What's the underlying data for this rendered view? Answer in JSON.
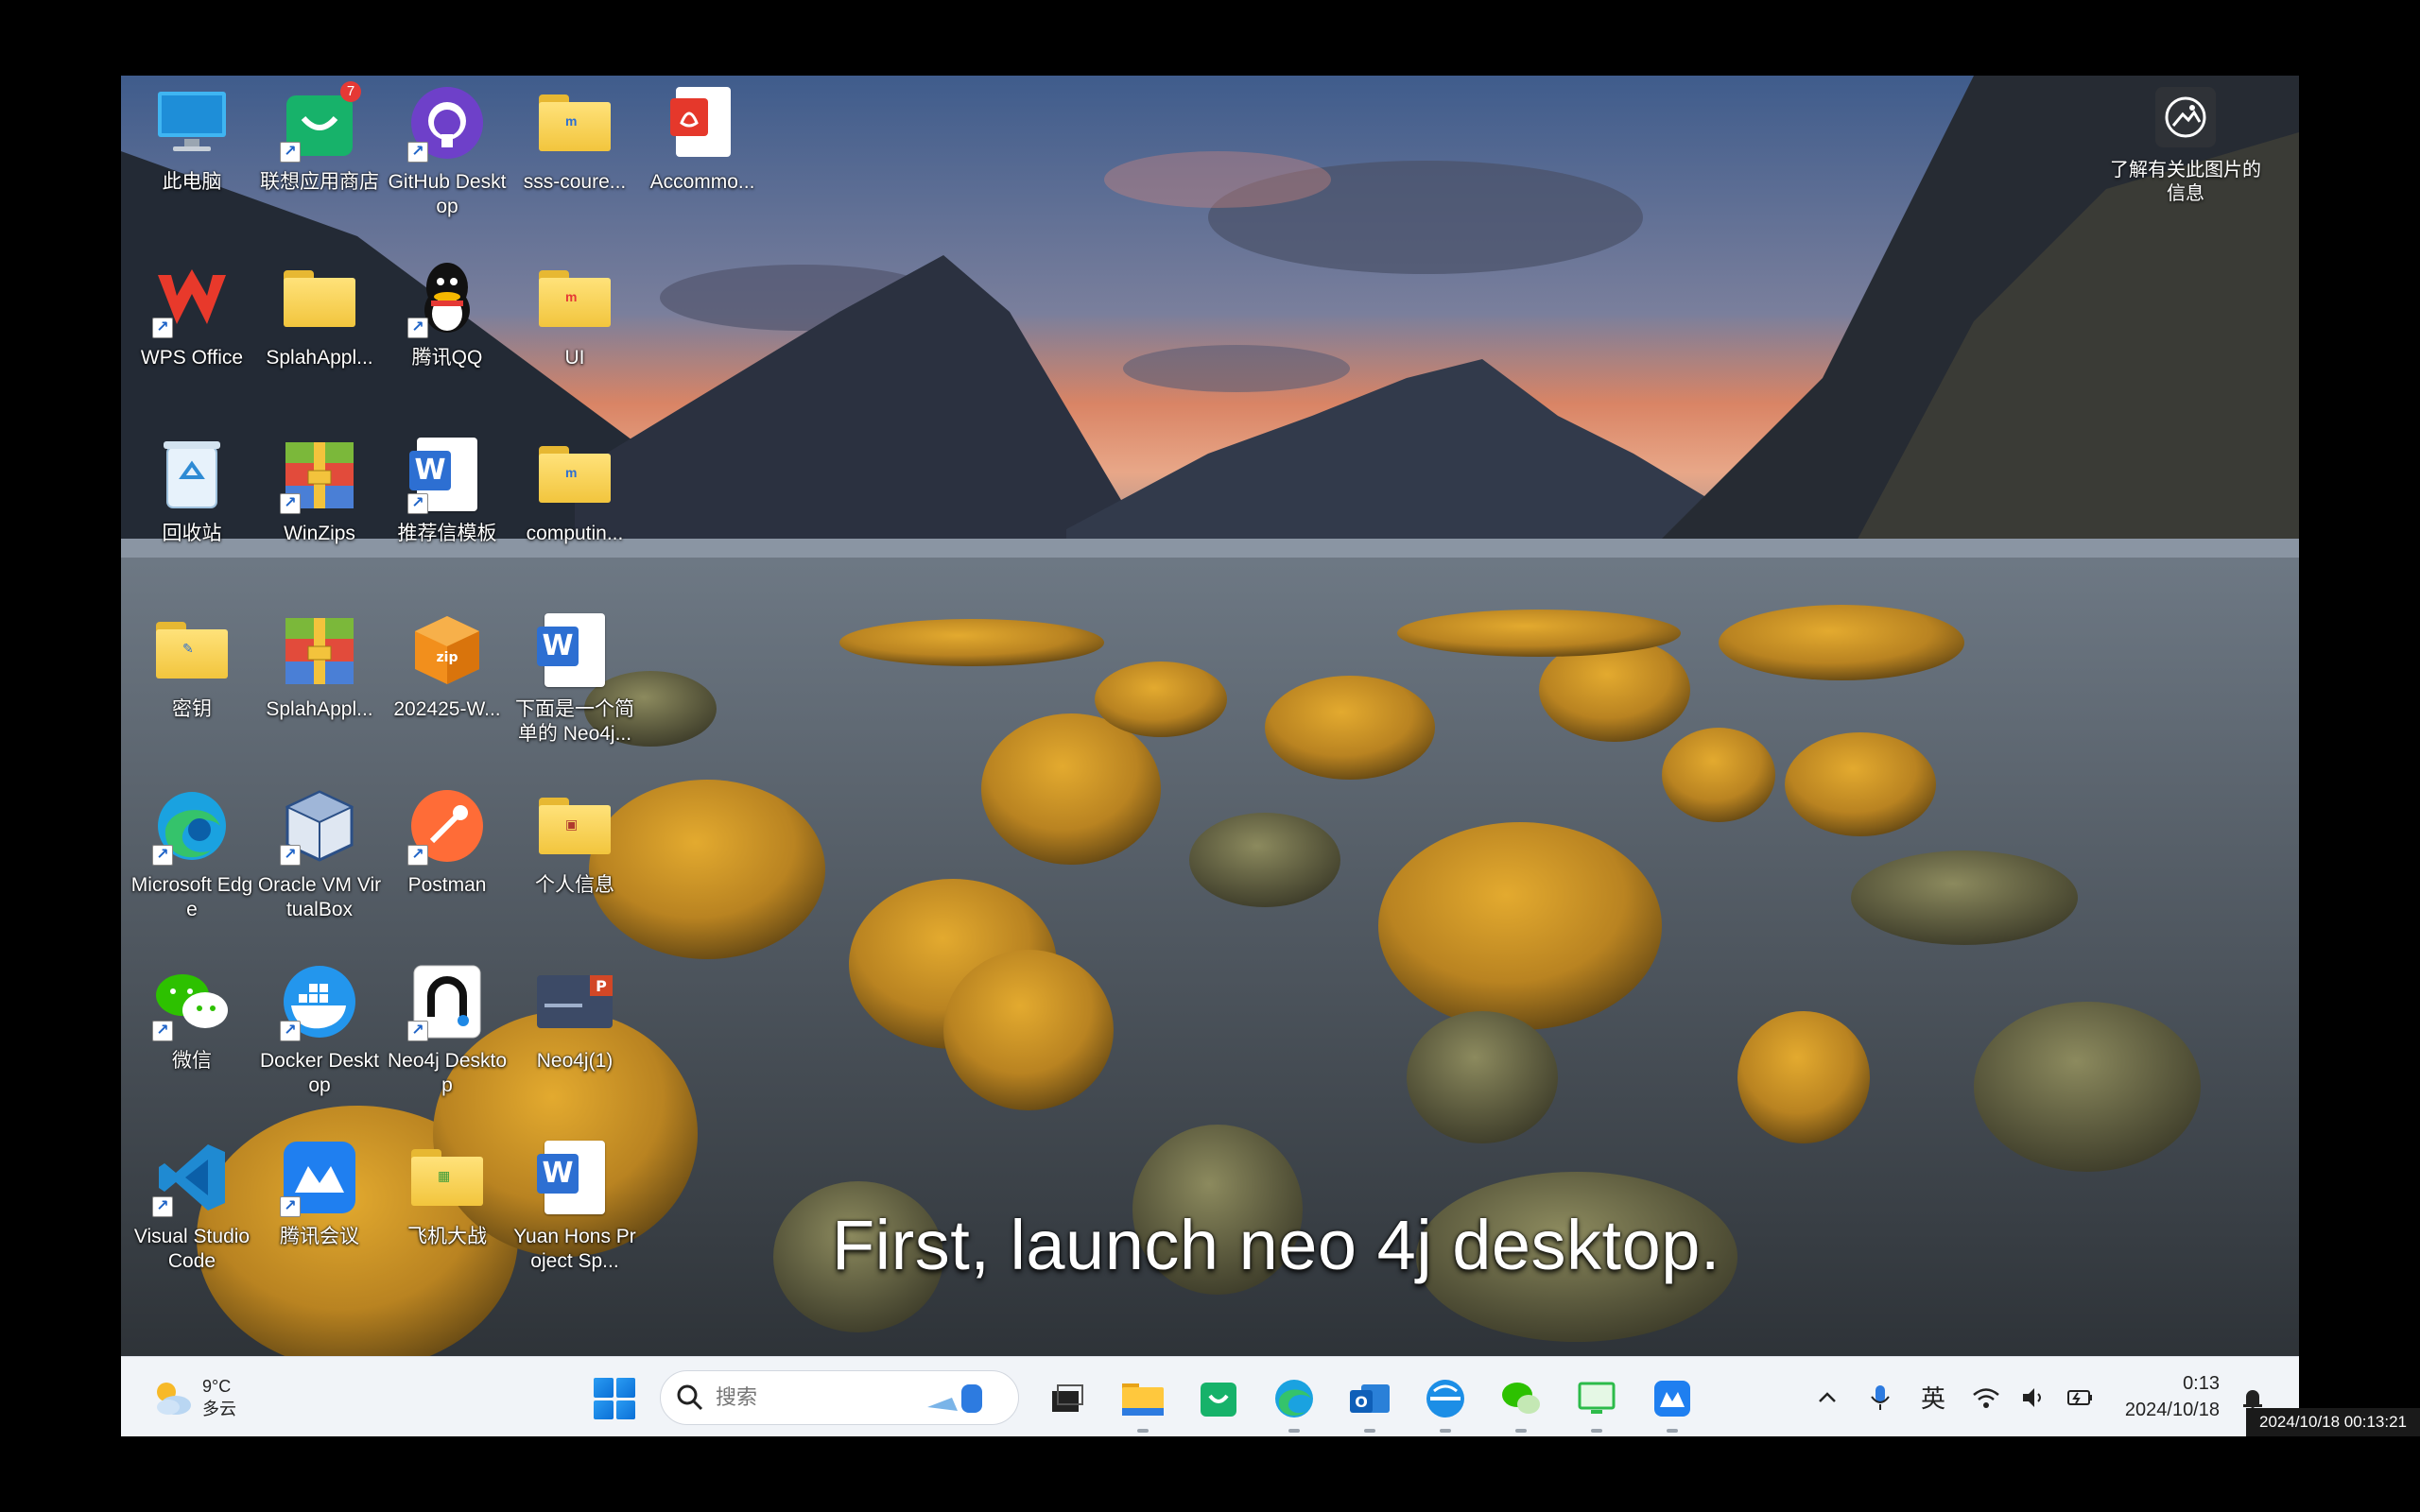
{
  "desktop": {
    "icons": [
      {
        "label": "此电脑",
        "icon": "computer-icon"
      },
      {
        "label": "联想应用商店",
        "icon": "lenovo-store-icon",
        "badge": "7"
      },
      {
        "label": "GitHub Desktop",
        "icon": "github-icon"
      },
      {
        "label": "sss-coure...",
        "icon": "folder-icon"
      },
      {
        "label": "Accommo...",
        "icon": "pdf-icon"
      },
      {
        "label": "WPS Office",
        "icon": "wps-icon"
      },
      {
        "label": "SplahAppl...",
        "icon": "folder-icon"
      },
      {
        "label": "腾讯QQ",
        "icon": "qq-icon"
      },
      {
        "label": "UI",
        "icon": "folder-icon"
      },
      {
        "label": "回收站",
        "icon": "recycle-bin-icon"
      },
      {
        "label": "WinZips",
        "icon": "winzip-icon"
      },
      {
        "label": "推荐信模板",
        "icon": "word-doc-icon"
      },
      {
        "label": "computin...",
        "icon": "folder-icon"
      },
      {
        "label": "密钥",
        "icon": "folder-icon"
      },
      {
        "label": "SplahAppl...",
        "icon": "winzip-icon"
      },
      {
        "label": "202425-W...",
        "icon": "archive-icon"
      },
      {
        "label": "下面是一个简单的 Neo4j...",
        "icon": "word-doc-icon"
      },
      {
        "label": "Microsoft Edge",
        "icon": "edge-icon"
      },
      {
        "label": "Oracle VM VirtualBox",
        "icon": "virtualbox-icon"
      },
      {
        "label": "Postman",
        "icon": "postman-icon"
      },
      {
        "label": "个人信息",
        "icon": "folder-icon"
      },
      {
        "label": "微信",
        "icon": "wechat-icon"
      },
      {
        "label": "Docker Desktop",
        "icon": "docker-icon"
      },
      {
        "label": "Neo4j Desktop",
        "icon": "neo4j-icon"
      },
      {
        "label": "Neo4j(1)",
        "icon": "ppt-icon"
      },
      {
        "label": "Visual Studio Code",
        "icon": "vscode-icon"
      },
      {
        "label": "腾讯会议",
        "icon": "tencent-meeting-icon"
      },
      {
        "label": "飞机大战",
        "icon": "folder-icon"
      },
      {
        "label": "Yuan Hons Project Sp...",
        "icon": "word-doc-icon"
      }
    ]
  },
  "info_widget": {
    "label": "了解有关此图片的信息"
  },
  "subtitle": "First, launch neo 4j desktop.",
  "taskbar": {
    "weather": {
      "temp": "9°C",
      "condition": "多云"
    },
    "search_placeholder": "搜索",
    "pinned_apps": [
      "file-explorer-icon",
      "folder-icon",
      "lenovo-store-icon",
      "edge-icon",
      "outlook-icon",
      "browser-icon",
      "wechat-icon",
      "remote-desktop-icon",
      "tencent-meeting-icon"
    ],
    "tray": {
      "ime": "英"
    },
    "clock": {
      "time": "0:13",
      "date": "2024/10/18"
    }
  },
  "recorder_stamp": "2024/10/18 00:13:21",
  "colors": {
    "taskbar_bg": "#f1f4f8",
    "accent": "#0b6fd6"
  }
}
